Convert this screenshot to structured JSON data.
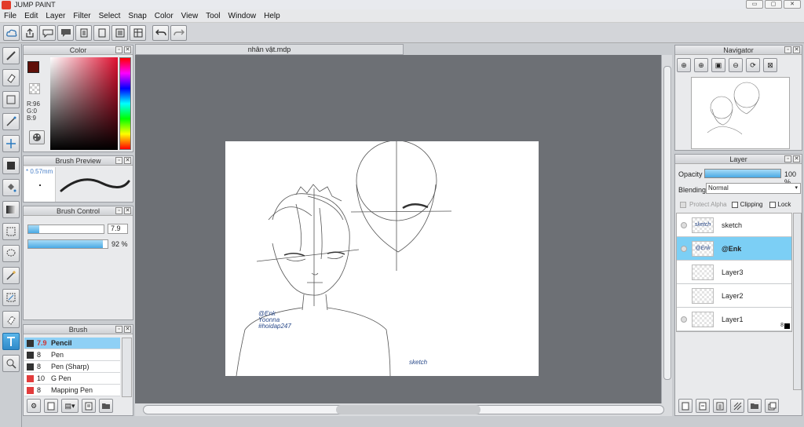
{
  "app": {
    "title": "JUMP PAINT"
  },
  "window_controls": {
    "minimize": "▭",
    "restore": "▢",
    "close": "✕"
  },
  "menu": [
    "File",
    "Edit",
    "Layer",
    "Filter",
    "Select",
    "Snap",
    "Color",
    "View",
    "Tool",
    "Window",
    "Help"
  ],
  "document": {
    "tab_label": "nhân vật.mdp"
  },
  "color_panel": {
    "title": "Color",
    "primary_color": "#601009",
    "r_label": "R:96",
    "g_label": "G:0",
    "b_label": "B:9"
  },
  "brush_preview": {
    "title": "Brush Preview",
    "size_label": "* 0.57mm"
  },
  "brush_control": {
    "title": "Brush Control",
    "size_value": "7.9",
    "opacity_value": "92 %",
    "size_fraction": 0.079,
    "opacity_fraction": 0.92
  },
  "brush_panel": {
    "title": "Brush",
    "items": [
      {
        "size": "7.9",
        "name": "Pencil",
        "color": "#333333",
        "selected": true
      },
      {
        "size": "8",
        "name": "Pen",
        "color": "#333333",
        "selected": false
      },
      {
        "size": "8",
        "name": "Pen (Sharp)",
        "color": "#333333",
        "selected": false
      },
      {
        "size": "10",
        "name": "G Pen",
        "color": "#e23c3c",
        "selected": false
      },
      {
        "size": "8",
        "name": "Mapping Pen",
        "color": "#e23c3c",
        "selected": false
      }
    ]
  },
  "navigator": {
    "title": "Navigator"
  },
  "layer_panel": {
    "title": "Layer",
    "opacity_label": "Opacity",
    "opacity_value": "100 %",
    "blending_label": "Blending",
    "blending_value": "Normal",
    "protect_alpha": "Protect Alpha",
    "clipping": "Clipping",
    "lock": "Lock",
    "layers": [
      {
        "name": "sketch",
        "thumb_text": "sketch",
        "selected": false
      },
      {
        "name": "@Enk",
        "thumb_text": "@Enk",
        "selected": true
      },
      {
        "name": "Layer3",
        "thumb_text": "",
        "selected": false
      },
      {
        "name": "Layer2",
        "thumb_text": "",
        "selected": false
      },
      {
        "name": "Layer1",
        "thumb_text": "",
        "selected": false
      }
    ],
    "layer1_badge": "8"
  },
  "canvas": {
    "signature_line1": "@Enk",
    "signature_line2": "Yoonna",
    "signature_line3": "#hoidap247",
    "label_sketch": "sketch"
  }
}
